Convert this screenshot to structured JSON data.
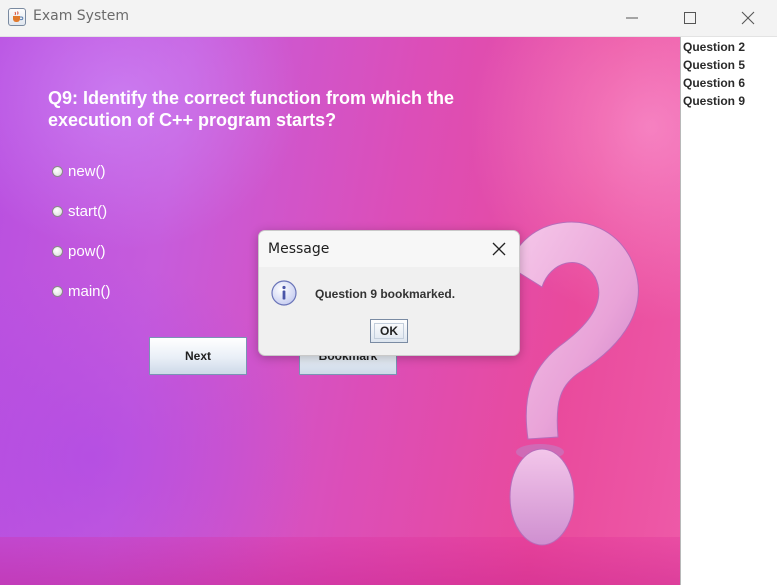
{
  "window": {
    "title": "Exam System"
  },
  "question": {
    "text": "Q9: Identify the correct function from which the execution of C++ program starts?",
    "options": [
      "new()",
      "start()",
      "pow()",
      "main()"
    ]
  },
  "buttons": {
    "next_label": "Next",
    "bookmark_label": "Bookmark"
  },
  "bookmarks": {
    "items": [
      "Question 2",
      "Question 5",
      "Question 6",
      "Question 9"
    ]
  },
  "dialog": {
    "title": "Message",
    "message": "Question 9 bookmarked.",
    "ok_label": "OK"
  },
  "colors": {
    "background_start": "#b84fe0",
    "background_end": "#ee5aa8",
    "question_text": "#ffffff"
  },
  "icons": {
    "app": "java-coffee-cup-icon",
    "dialog": "info-icon",
    "decoration": "question-mark-graphic"
  }
}
